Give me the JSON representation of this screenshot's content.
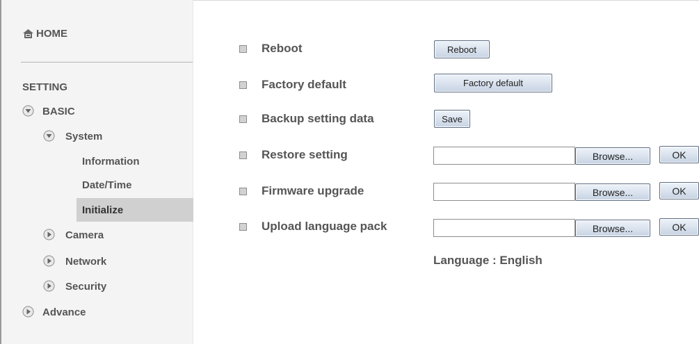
{
  "sidebar": {
    "home_label": "HOME",
    "setting_label": "SETTING",
    "basic_label": "BASIC",
    "system_label": "System",
    "information_label": "Information",
    "datetime_label": "Date/Time",
    "initialize_label": "Initialize",
    "camera_label": "Camera",
    "network_label": "Network",
    "security_label": "Security",
    "advance_label": "Advance"
  },
  "main": {
    "reboot": {
      "label": "Reboot",
      "button": "Reboot"
    },
    "factory_default": {
      "label": "Factory default",
      "button": "Factory default"
    },
    "backup": {
      "label": "Backup setting data",
      "button": "Save"
    },
    "restore": {
      "label": "Restore setting",
      "file_value": "",
      "browse": "Browse...",
      "ok": "OK"
    },
    "firmware": {
      "label": "Firmware upgrade",
      "file_value": "",
      "browse": "Browse...",
      "ok": "OK"
    },
    "language_pack": {
      "label": "Upload language pack",
      "file_value": "",
      "browse": "Browse...",
      "ok": "OK"
    },
    "language_status": "Language : English"
  },
  "colors": {
    "sidebar_bg": "#f4f4f4",
    "selected_bg": "#d0d0d0",
    "text": "#555555",
    "button_top": "#eef3f9",
    "button_bottom": "#c7d3e3"
  },
  "icons": {
    "home": "home-icon",
    "expanded": "chevron-down-icon",
    "collapsed": "chevron-right-icon"
  }
}
